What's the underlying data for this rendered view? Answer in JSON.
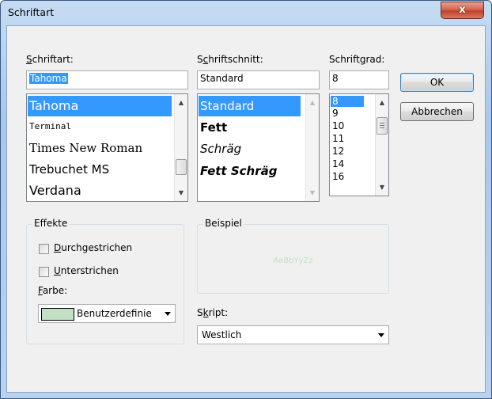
{
  "window": {
    "title": "Schriftart",
    "close_glyph": "x"
  },
  "font": {
    "label_pre": "",
    "label_key": "S",
    "label_post": "chriftart:",
    "value": "Tahoma",
    "items": [
      "Tahoma",
      "Terminal",
      "Times New Roman",
      "Trebuchet MS",
      "Verdana"
    ],
    "selected_index": 0
  },
  "style": {
    "label_pre": "S",
    "label_key": "c",
    "label_post": "hriftschnitt:",
    "value": "Standard",
    "items": [
      "Standard",
      "Fett",
      "Schräg",
      "Fett Schräg"
    ],
    "selected_index": 0
  },
  "size": {
    "label_pre": "Schrift",
    "label_key": "g",
    "label_post": "rad:",
    "value": "8",
    "items": [
      "8",
      "9",
      "10",
      "11",
      "12",
      "14",
      "16"
    ],
    "selected_index": 0
  },
  "buttons": {
    "ok": "OK",
    "cancel": "Abbrechen"
  },
  "effects": {
    "title": "Effekte",
    "strike_key": "D",
    "strike_rest": "urchgestrichen",
    "underline_key": "U",
    "underline_rest": "nterstrichen",
    "strike_checked": false,
    "underline_checked": false,
    "color_label_key": "F",
    "color_label_rest": "arbe:",
    "color_value": "Benutzerdefinie",
    "color_swatch": "#c3e0c6"
  },
  "sample": {
    "title": "Beispiel",
    "text": "AaBbYyZz",
    "text_color": "#c3e0c6"
  },
  "script": {
    "label_pre": "S",
    "label_key": "k",
    "label_post": "ript:",
    "value": "Westlich"
  },
  "colors": {
    "selection": "#3399ff",
    "dialog_bg": "#f0f0f0"
  }
}
